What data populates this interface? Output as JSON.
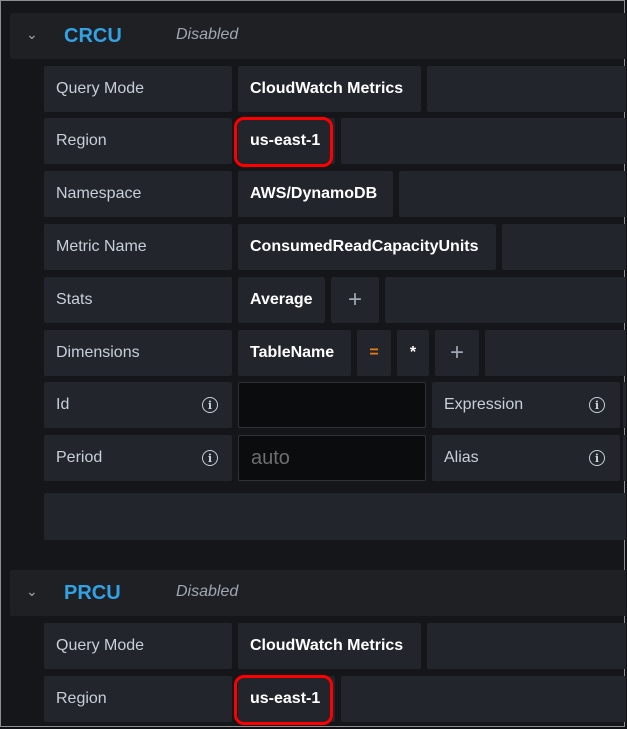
{
  "sections": [
    {
      "chevron": "⌄",
      "title": "CRCU",
      "status": "Disabled",
      "rows": {
        "query_mode": {
          "label": "Query Mode",
          "value": "CloudWatch Metrics"
        },
        "region": {
          "label": "Region",
          "value": "us-east-1"
        },
        "namespace": {
          "label": "Namespace",
          "value": "AWS/DynamoDB"
        },
        "metric_name": {
          "label": "Metric Name",
          "value": "ConsumedReadCapacityUnits"
        },
        "stats": {
          "label": "Stats",
          "value": "Average",
          "add": "+"
        },
        "dimensions": {
          "label": "Dimensions",
          "key": "TableName",
          "operator": "=",
          "value": "*",
          "add": "+"
        },
        "id": {
          "label": "Id",
          "value": ""
        },
        "expression": {
          "label": "Expression"
        },
        "period": {
          "label": "Period",
          "placeholder": "auto"
        },
        "alias": {
          "label": "Alias"
        }
      }
    },
    {
      "chevron": "⌄",
      "title": "PRCU",
      "status": "Disabled",
      "rows": {
        "query_mode": {
          "label": "Query Mode",
          "value": "CloudWatch Metrics"
        },
        "region": {
          "label": "Region",
          "value": "us-east-1"
        }
      }
    }
  ],
  "icons": {
    "info": "i"
  },
  "colors": {
    "accent": "#33a2e5",
    "highlight": "#ff0000",
    "operator": "#eb7b18"
  }
}
